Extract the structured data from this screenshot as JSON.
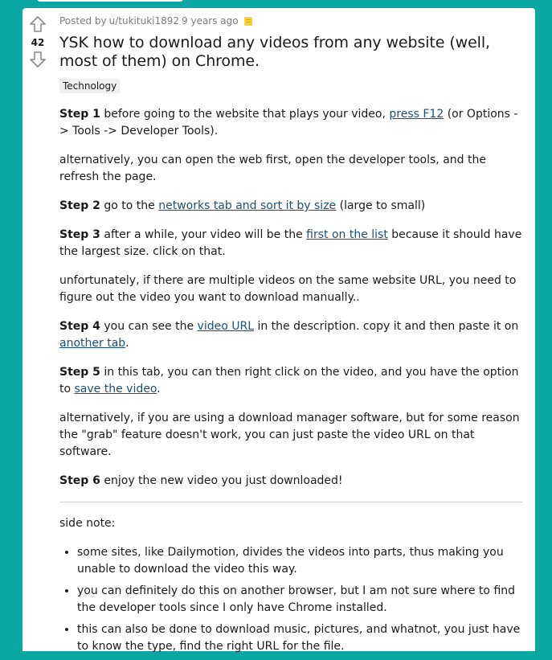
{
  "post": {
    "vote_count": "42",
    "posted_by_prefix": "Posted by",
    "author": "u/tukituki1892",
    "time_ago": "9 years ago",
    "title": "YSK how to download any videos from any website (well, most of them) on Chrome.",
    "flair": "Technology"
  },
  "body": {
    "s1_bold": "Step 1",
    "s1_text_a": " before going to the website that plays your video, ",
    "s1_link": "press F12",
    "s1_text_b": " (or Options -> Tools -> Developer Tools).",
    "p_alt1": "alternatively, you can open the web first, open the developer tools, and the refresh the page.",
    "s2_bold": "Step 2",
    "s2_text_a": " go to the ",
    "s2_link": "networks tab and sort it by size",
    "s2_text_b": " (large to small)",
    "s3_bold": "Step 3",
    "s3_text_a": " after a while, your video will be the ",
    "s3_link": "first on the list",
    "s3_text_b": " because it should have the largest size. click on that.",
    "p_unfortunately": "unfortunately, if there are multiple videos on the same website URL, you need to figure out the video you want to download manually..",
    "s4_bold": "Step 4",
    "s4_text_a": " you can see the ",
    "s4_link1": "video URL",
    "s4_text_b": " in the description. copy it and then paste it on ",
    "s4_link2": "another tab",
    "s4_text_c": ".",
    "s5_bold": "Step 5",
    "s5_text_a": " in this tab, you can then right click on the video, and you have the option to ",
    "s5_link": "save the video",
    "s5_text_b": ".",
    "p_alt2": "alternatively, if you are using a download manager software, but for some reason the \"grab\" feature doesn't work, you can just paste the video URL on that software.",
    "s6_bold": "Step 6",
    "s6_text": " enjoy the new video you just downloaded!",
    "side_note": "side note:",
    "notes": [
      "some sites, like Dailymotion, divides the videos into parts, thus making you unable to download the video this way.",
      "you can definitely do this on another browser, but I am not sure where to find the developer tools since I only have Chrome installed.",
      "this can also be done to download music, pictures, and whatnot, you just have to know the type, find the right URL for the file."
    ]
  },
  "icons": {
    "upvote": "upvote-arrow-icon",
    "downvote": "downvote-arrow-icon",
    "award": "award-icon"
  },
  "colors": {
    "background": "#0aa7a2",
    "link": "#1c4f76",
    "meta": "#787c7e"
  }
}
